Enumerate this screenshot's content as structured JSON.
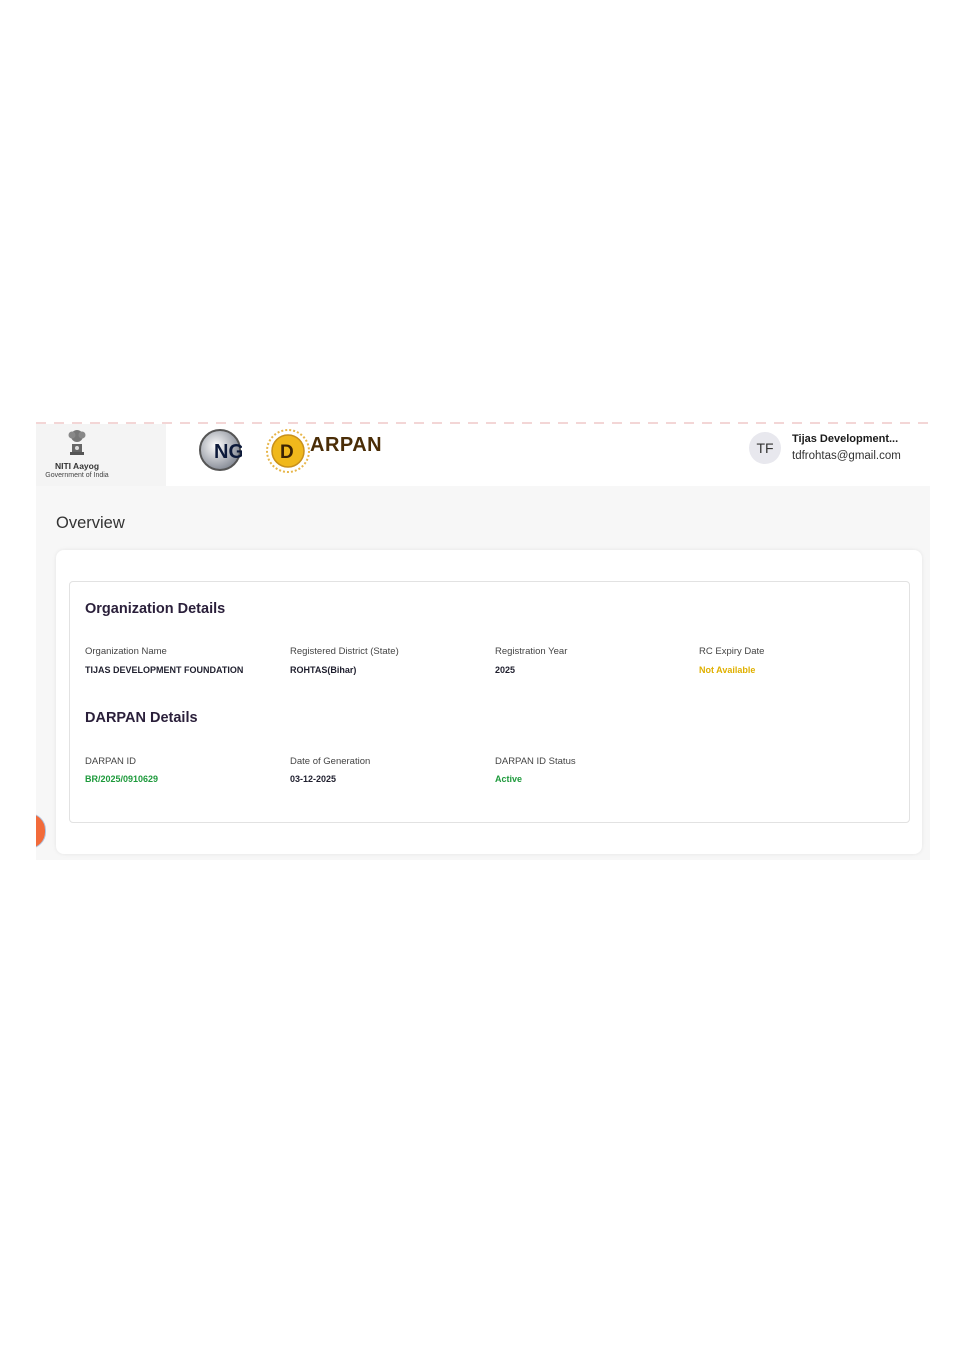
{
  "header": {
    "niti_name": "NITI Aayog",
    "niti_subtitle": "Government of India",
    "ngo_logo_text": "NG",
    "darpan_logo_letter": "D",
    "darpan_logo_word": "ARPAN",
    "user_initials": "TF",
    "user_name": "Tijas Development...",
    "user_email": "tdfrohtas@gmail.com"
  },
  "page": {
    "title": "Overview"
  },
  "organization_details": {
    "title": "Organization Details",
    "fields": [
      {
        "label": "Organization Name",
        "value": "TIJAS DEVELOPMENT FOUNDATION"
      },
      {
        "label": "Registered District (State)",
        "value": "ROHTAS(Bihar)"
      },
      {
        "label": "Registration Year",
        "value": "2025"
      },
      {
        "label": "RC Expiry Date",
        "value": "Not Available"
      }
    ]
  },
  "darpan_details": {
    "title": "DARPAN Details",
    "fields": [
      {
        "label": "DARPAN ID",
        "value": "BR/2025/0910629"
      },
      {
        "label": "Date of Generation",
        "value": "03-12-2025"
      },
      {
        "label": "DARPAN ID Status",
        "value": "Active"
      }
    ]
  },
  "colors": {
    "accent_green": "#1e9a3c",
    "accent_yellow": "#e0b000",
    "brand_brown": "#4a2d07",
    "orange": "#f26b3a"
  }
}
